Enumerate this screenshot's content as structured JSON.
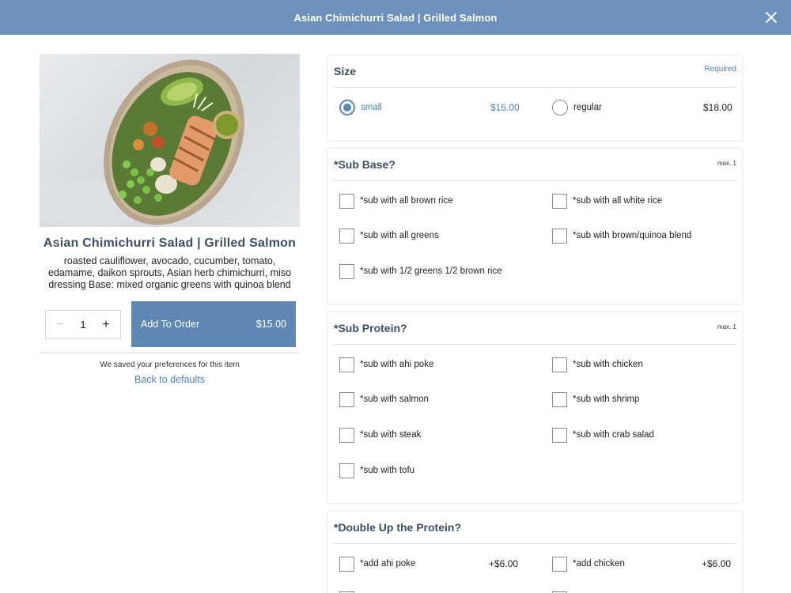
{
  "header": {
    "title": "Asian Chimichurri Salad | Grilled Salmon"
  },
  "item": {
    "title": "Asian Chimichurri Salad | Grilled Salmon",
    "description": "roasted cauliflower, avocado, cucumber, tomato, edamame, daikon sprouts, Asian herb chimichurri, miso dressing Base: mixed organic greens with quinoa blend"
  },
  "order": {
    "quantity": "1",
    "minus": "−",
    "plus": "+",
    "add_label": "Add To Order",
    "add_price": "$15.00"
  },
  "preferences": {
    "saved_text": "We saved your preferences for this item",
    "back_link": "Back to defaults"
  },
  "size": {
    "title": "Size",
    "required": "Required",
    "options": [
      {
        "label": "small",
        "price": "$15.00",
        "selected": true
      },
      {
        "label": "regular",
        "price": "$18.00",
        "selected": false
      }
    ]
  },
  "sub_base": {
    "title": "*Sub Base?",
    "max": "max. 1",
    "options": [
      "*sub with all brown rice",
      "*sub with all white rice",
      "*sub with all greens",
      "*sub with brown/quinoa blend",
      "*sub with 1/2 greens 1/2 brown rice"
    ]
  },
  "sub_protein": {
    "title": "*Sub Protein?",
    "max": "max. 1",
    "options": [
      "*sub with ahi poke",
      "*sub with chicken",
      "*sub with salmon",
      "*sub with shrimp",
      "*sub with steak",
      "*sub with crab salad",
      "*sub with tofu"
    ]
  },
  "double_protein": {
    "title": "*Double Up the Protein?",
    "options": [
      {
        "label": "*add ahi poke",
        "price": "+$6.00"
      },
      {
        "label": "*add chicken",
        "price": "+$6.00"
      }
    ]
  },
  "colors": {
    "header_bg": "#6c92bb",
    "accent": "#5e87b3",
    "link": "#4f81b5"
  }
}
